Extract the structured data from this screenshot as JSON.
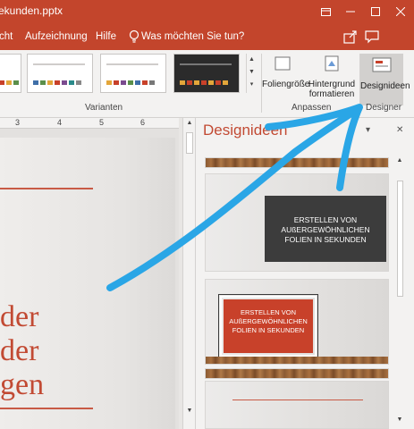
{
  "titlebar": {
    "title": "ekunden.pptx",
    "controls": [
      "ribbon-display-icon",
      "minimize-icon",
      "maximize-icon",
      "close-icon"
    ]
  },
  "ribbon_tabs": {
    "tabs": [
      "cht",
      "Aufzeichnung",
      "Hilfe"
    ],
    "tell_me": "Was möchten Sie tun?",
    "right_tools": [
      "share-icon",
      "comments-icon"
    ]
  },
  "ribbon": {
    "variants_label": "Varianten",
    "anpassen_label": "Anpassen",
    "designer_label": "Designer",
    "buttons": {
      "foliengroesse": "Foliengröße",
      "hintergrund_line1": "Hintergrund",
      "hintergrund_line2": "formatieren",
      "designideen": "Designideen"
    },
    "variant_colors": [
      [
        "#c8412a",
        "#e3a63a",
        "#5b8f4a",
        "#3f6fa8",
        "#7a4b8f",
        "#c8412a",
        "#999999"
      ],
      [
        "#3f6fa8",
        "#5b8f4a",
        "#e3a63a",
        "#c8412a",
        "#7a4b8f",
        "#2a8a8a",
        "#888888"
      ],
      [
        "#e3a63a",
        "#c8412a",
        "#7a4b8f",
        "#5b8f4a",
        "#3f6fa8",
        "#c8412a",
        "#777777"
      ],
      [
        "#e3a63a",
        "#c8412a",
        "#e3a63a",
        "#c8412a",
        "#e3a63a",
        "#c8412a",
        "#e3a63a"
      ]
    ]
  },
  "ruler": {
    "ticks": [
      "3",
      "4",
      "5",
      "6"
    ]
  },
  "slide": {
    "lines": [
      "der",
      "der",
      "gen"
    ],
    "accent": "#c24a33"
  },
  "design_pane": {
    "title": "Designideen",
    "controls": [
      "chevron-down-icon",
      "close-icon"
    ],
    "thumbnails": [
      {
        "style": "dark-box",
        "lines": [
          "ERSTELLEN VON",
          "AUßERGEWÖHNLICHEN",
          "FOLIEN IN SEKUNDEN"
        ]
      },
      {
        "style": "red-box",
        "lines": [
          "ERSTELLEN VON",
          "AUßERGEWÖHNLICHEN",
          "FOLIEN IN SEKUNDEN"
        ]
      },
      {
        "style": "plain",
        "lines": []
      }
    ]
  },
  "annotation": {
    "color": "#2aa6e6"
  }
}
